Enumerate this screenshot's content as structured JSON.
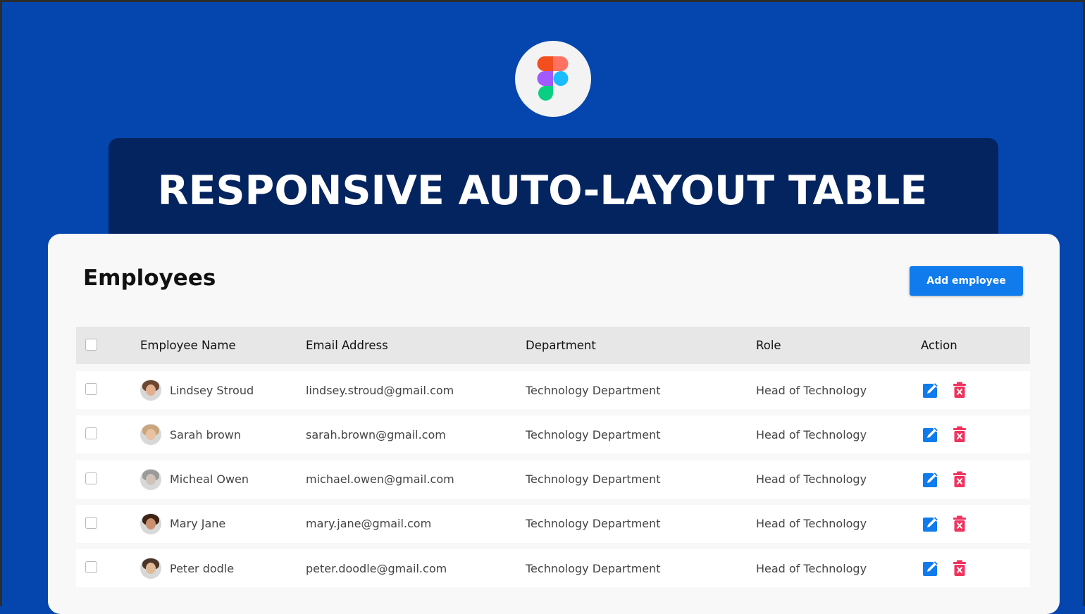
{
  "banner": {
    "title": "RESPONSIVE AUTO-LAYOUT TABLE"
  },
  "card": {
    "title": "Employees",
    "add_button": "Add employee"
  },
  "table": {
    "headers": [
      "Employee Name",
      "Email Address",
      "Department",
      "Role",
      "Action"
    ],
    "rows": [
      {
        "name": "Lindsey Stroud",
        "email": "lindsey.stroud@gmail.com",
        "department": "Technology Department",
        "role": "Head of Technology"
      },
      {
        "name": "Sarah brown",
        "email": "sarah.brown@gmail.com",
        "department": "Technology Department",
        "role": "Head of Technology"
      },
      {
        "name": "Micheal Owen",
        "email": "michael.owen@gmail.com",
        "department": "Technology Department",
        "role": "Head of Technology"
      },
      {
        "name": "Mary Jane",
        "email": "mary.jane@gmail.com",
        "department": "Technology Department",
        "role": "Head of Technology"
      },
      {
        "name": "Peter dodle",
        "email": "peter.doodle@gmail.com",
        "department": "Technology Department",
        "role": "Head of Technology"
      }
    ]
  },
  "icons": {
    "logo": "figma-logo-icon",
    "edit": "edit-icon",
    "delete": "trash-icon"
  },
  "colors": {
    "background": "#0446ad",
    "banner": "#042460",
    "primary_button": "#0f7bec",
    "edit_icon": "#0f7bec",
    "delete_icon": "#f0335e"
  }
}
